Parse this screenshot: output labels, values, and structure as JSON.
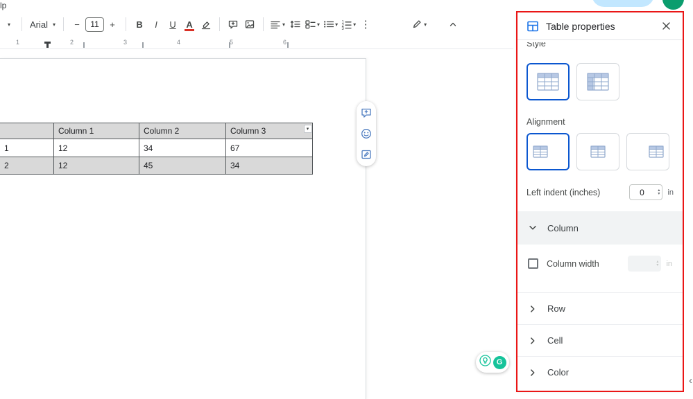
{
  "app": {
    "menu_fragment": "lp"
  },
  "toolbar": {
    "font_name": "Arial",
    "font_size": "11",
    "labels": {
      "bold": "B",
      "italic": "I",
      "underline": "U",
      "text_color": "A"
    }
  },
  "ruler": {
    "numbers": [
      "1",
      "2",
      "3",
      "4",
      "5",
      "6"
    ]
  },
  "doc": {
    "table": {
      "header": [
        "",
        "Column 1",
        "Column 2",
        "Column 3"
      ],
      "rows": [
        [
          "1",
          "12",
          "34",
          "67"
        ],
        [
          "2",
          "12",
          "45",
          "34"
        ]
      ]
    }
  },
  "panel": {
    "title": "Table properties",
    "style_label": "Style",
    "alignment_label": "Alignment",
    "left_indent": {
      "label": "Left indent (inches)",
      "value": "0",
      "unit": "in"
    },
    "column": {
      "label": "Column",
      "width_label": "Column width",
      "unit": "in"
    },
    "row_label": "Row",
    "cell_label": "Cell",
    "color_label": "Color"
  },
  "grammarly": {
    "letter": "G"
  },
  "colors": {
    "annotation": "#ea1616",
    "selected_border": "#0b57d0",
    "table_header_bg": "#d9d9d9",
    "grammarly_green": "#15c39a",
    "avatar_green": "#0b9d6e"
  }
}
